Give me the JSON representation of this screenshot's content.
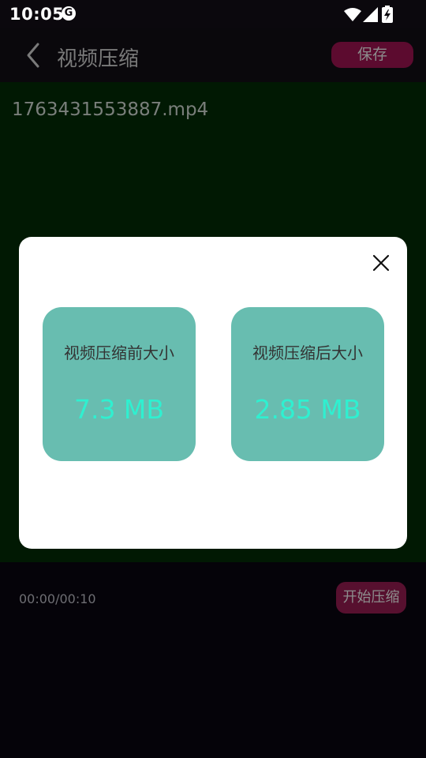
{
  "status_bar": {
    "time": "10:05",
    "app_icon_glyph": "G",
    "icons": [
      "wifi-icon",
      "signal-icon",
      "battery-charging-icon"
    ]
  },
  "app_bar": {
    "title": "视频压缩",
    "save_label": "保存",
    "back_icon": "chevron-left-icon"
  },
  "video": {
    "file_name": "1763431553887.mp4"
  },
  "controls": {
    "time": "00:00/00:10",
    "start_label": "开始压缩"
  },
  "dialog": {
    "close_icon": "close-icon",
    "before": {
      "label": "视频压缩前大小",
      "value": "7.3 MB"
    },
    "after": {
      "label": "视频压缩后大小",
      "value": "2.85 MB"
    }
  },
  "colors": {
    "card_background": "#68bdb0",
    "card_value": "#2ff0d0",
    "accent_button": "#5c0b2f",
    "video_background": "#011903"
  }
}
